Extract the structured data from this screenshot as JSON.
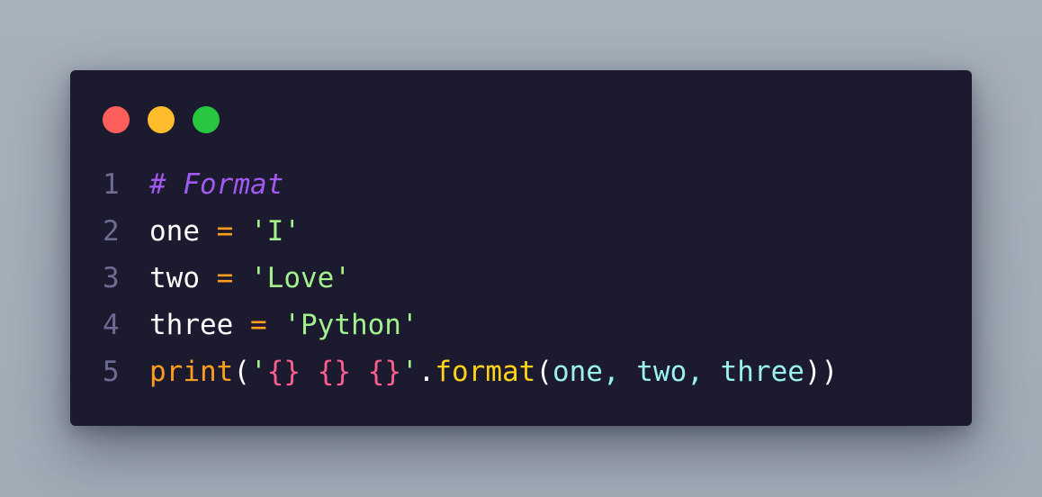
{
  "window": {
    "controls": [
      {
        "name": "close",
        "color": "#ff5f5a"
      },
      {
        "name": "minimize",
        "color": "#ffbd2e"
      },
      {
        "name": "maximize",
        "color": "#27c840"
      }
    ]
  },
  "colors": {
    "background": "#a2adb8",
    "editor": "#1b1a2f",
    "line_number": "#6e6c93",
    "comment": "#a259f0",
    "identifier": "#ffffff",
    "operator": "#ff9d1d",
    "string": "#a3f08c",
    "format_braces": "#ff5f8f",
    "method": "#ffd21a",
    "argument": "#9af1f0"
  },
  "code": {
    "lines": [
      {
        "number": "1",
        "tokens": [
          {
            "text": "# Format",
            "kind": "comment"
          }
        ]
      },
      {
        "number": "2",
        "tokens": [
          {
            "text": "one",
            "kind": "name"
          },
          {
            "text": " = ",
            "kind": "op"
          },
          {
            "text": "'I'",
            "kind": "str"
          }
        ]
      },
      {
        "number": "3",
        "tokens": [
          {
            "text": "two",
            "kind": "name"
          },
          {
            "text": " = ",
            "kind": "op"
          },
          {
            "text": "'Love'",
            "kind": "str"
          }
        ]
      },
      {
        "number": "4",
        "tokens": [
          {
            "text": "three",
            "kind": "name"
          },
          {
            "text": " = ",
            "kind": "op"
          },
          {
            "text": "'Python'",
            "kind": "str"
          }
        ]
      },
      {
        "number": "5",
        "tokens": [
          {
            "text": "print",
            "kind": "builtin"
          },
          {
            "text": "(",
            "kind": "paren"
          },
          {
            "text": "'",
            "kind": "str"
          },
          {
            "text": "{} {} {}",
            "kind": "fmt"
          },
          {
            "text": "'",
            "kind": "str"
          },
          {
            "text": ".",
            "kind": "dot"
          },
          {
            "text": "format",
            "kind": "method"
          },
          {
            "text": "(",
            "kind": "paren"
          },
          {
            "text": "one, two, three",
            "kind": "arg"
          },
          {
            "text": "))",
            "kind": "paren"
          }
        ]
      }
    ]
  }
}
